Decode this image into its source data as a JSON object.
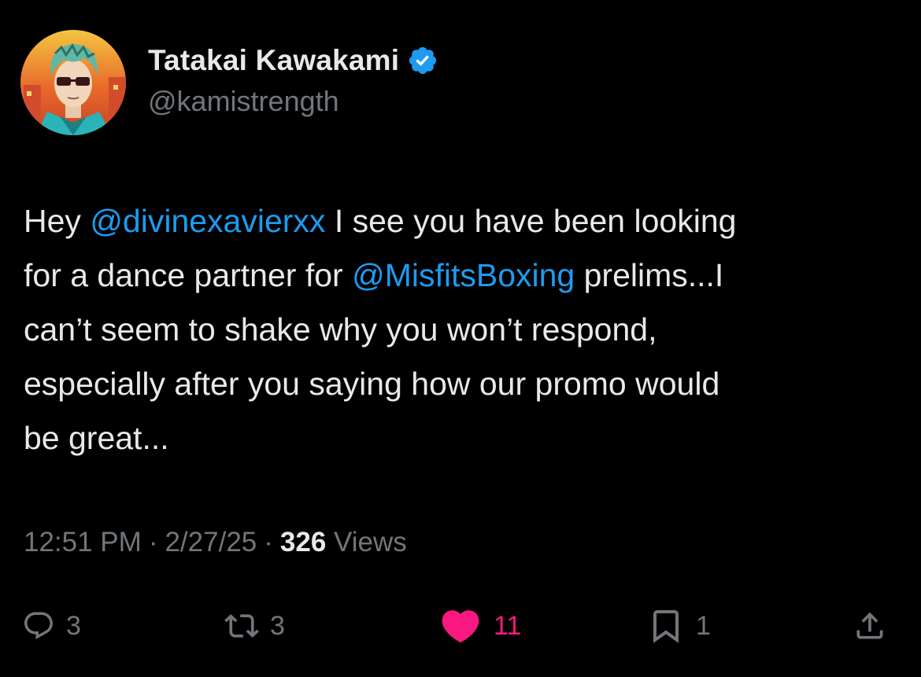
{
  "author": {
    "display_name": "Tatakai Kawakami",
    "handle": "@kamistrength",
    "verified": true,
    "avatar_icon": "avatar-illustration"
  },
  "tweet": {
    "lines": [
      [
        {
          "text": "Hey ",
          "type": "text"
        },
        {
          "text": "@divinexavierxx",
          "type": "mention"
        },
        {
          "text": " I see you have been looking",
          "type": "text"
        }
      ],
      [
        {
          "text": "for a dance partner for ",
          "type": "text"
        },
        {
          "text": "@MisfitsBoxing",
          "type": "mention"
        },
        {
          "text": " prelims...I",
          "type": "text"
        }
      ],
      [
        {
          "text": "can’t seem to shake why you won’t respond,",
          "type": "text"
        }
      ],
      [
        {
          "text": "especially after you saying how our promo would",
          "type": "text"
        }
      ],
      [
        {
          "text": "be great...",
          "type": "text"
        }
      ]
    ]
  },
  "meta": {
    "time": "12:51 PM",
    "separator": "·",
    "date": "2/27/25",
    "views_count": "326",
    "views_label": "Views"
  },
  "actions": {
    "reply": {
      "count": "3",
      "icon": "reply-icon"
    },
    "retweet": {
      "count": "3",
      "icon": "retweet-icon"
    },
    "like": {
      "count": "11",
      "icon": "heart-icon",
      "liked": true
    },
    "bookmark": {
      "count": "1",
      "icon": "bookmark-icon"
    },
    "share": {
      "icon": "share-icon"
    }
  },
  "colors": {
    "background": "#000000",
    "text_primary": "#e7e9ea",
    "text_secondary": "#71767b",
    "link": "#1d9bf0",
    "like": "#f91880",
    "verified": "#1d9bf0"
  }
}
